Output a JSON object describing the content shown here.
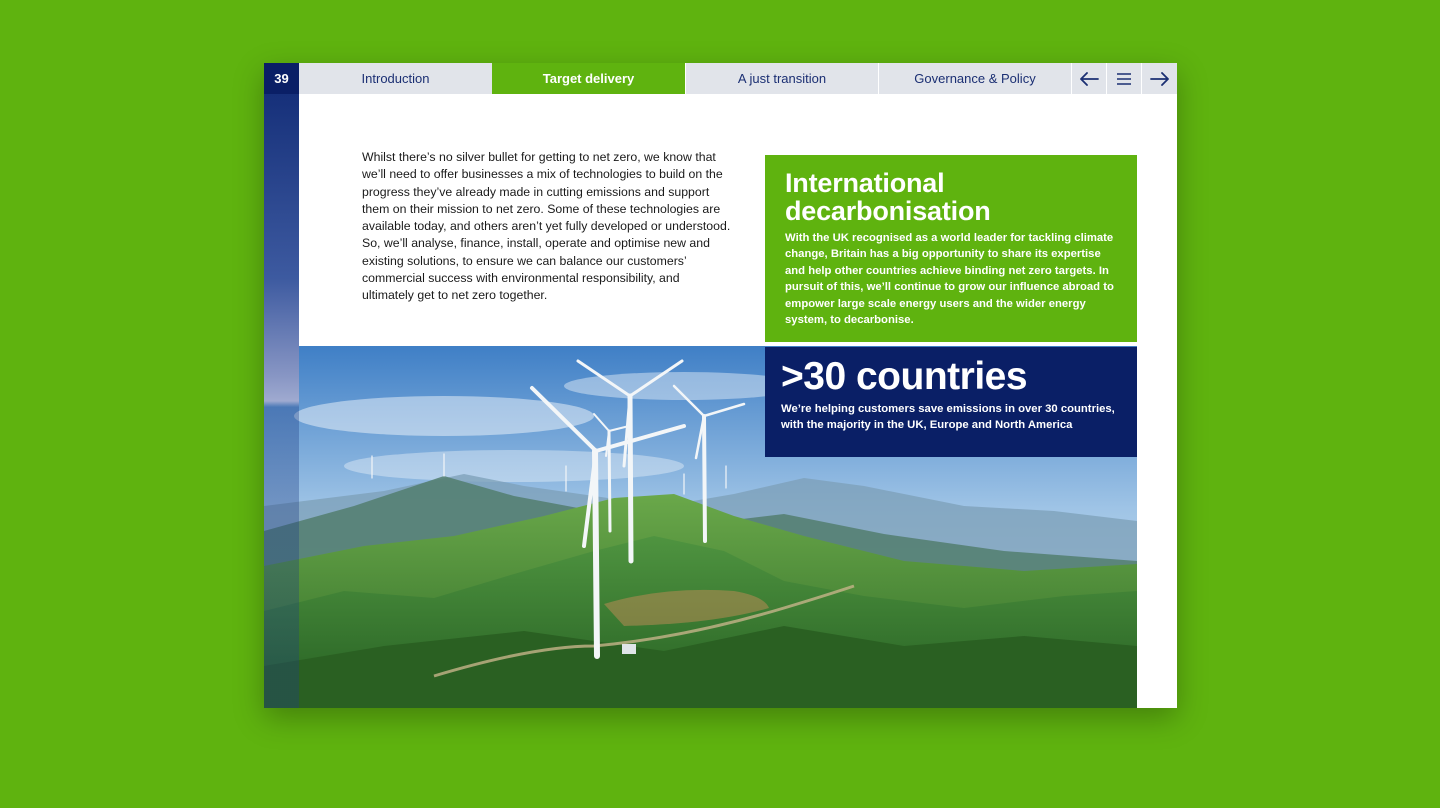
{
  "nav": {
    "page_number": "39",
    "tabs": [
      {
        "label": "Introduction",
        "active": false
      },
      {
        "label": "Target delivery",
        "active": true
      },
      {
        "label": "A just transition",
        "active": false
      },
      {
        "label": "Governance & Policy",
        "active": false
      }
    ],
    "prev_icon": "arrow-left-icon",
    "menu_icon": "hamburger-menu-icon",
    "next_icon": "arrow-right-icon"
  },
  "main": {
    "body_text": "Whilst there’s no silver bullet for getting to net zero, we know that we’ll need to offer businesses a mix of technologies to build on the progress they’ve already made in cutting emissions and support them on their mission to net zero. Some of these technologies are available today, and others aren’t yet fully developed or understood. So, we’ll analyse, finance, install, operate and optimise new and existing solutions, to ensure we can balance our customers’ commercial success with environmental responsibility, and ultimately get to net zero together."
  },
  "callout_green": {
    "title": "International decarbonisation",
    "text": "With the UK recognised as a world leader for tackling climate change, Britain has a big opportunity to share its expertise and help other countries achieve binding net zero targets. In pursuit of this, we’ll continue to grow our influence abroad to empower large scale energy users and the wider energy system, to decarbonise."
  },
  "callout_navy": {
    "stat": ">30 countries",
    "text": "We’re helping customers save emissions in over 30 countries, with the majority in the UK, Europe and North America"
  },
  "colors": {
    "background": "#5fb30f",
    "brand_navy": "#0a1f66",
    "brand_green": "#5fb30f",
    "tab_bar": "#e1e4ea",
    "tab_text": "#1b2f73"
  }
}
